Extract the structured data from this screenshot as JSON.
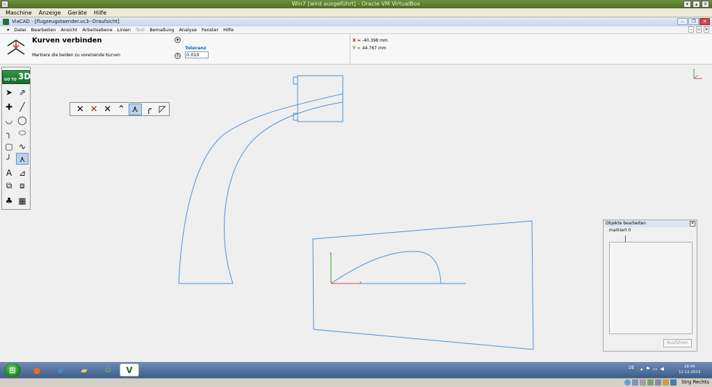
{
  "vbox": {
    "title": "Win7 [wird ausgeführt] - Oracle VM VirtualBox",
    "menu": [
      "Maschine",
      "Anzeige",
      "Geräte",
      "Hilfe"
    ],
    "host_key": "Strg Rechts"
  },
  "app": {
    "title": "ViaCAD - [flugzeugstaender.vc3--Draufsicht]",
    "menu": [
      "Datei",
      "Bearbeiten",
      "Ansicht",
      "Arbeitsebene",
      "Linien",
      "Text",
      "Bemaßung",
      "Analyse",
      "Fenster",
      "Hilfe"
    ],
    "menu_disabled": [
      "Text"
    ]
  },
  "command": {
    "title": "Kurven verbinden",
    "hint": "Markiere die beiden zu vereinende Kurven",
    "tolerance_label": "Toleranz",
    "tolerance_value": "0.010"
  },
  "coords": {
    "x_label": "X =",
    "x_value": "-40.398 mm",
    "y_label": "Y =",
    "y_value": "44.767 mm"
  },
  "toolbox": {
    "goto_label": "GO TO",
    "goto_3d": "3D"
  },
  "obj_panel": {
    "title": "Objekte bearbeiten",
    "marked": "markiert 0",
    "button": "Ausführen"
  },
  "taskbar": {
    "lang": "DE",
    "time": "18:44",
    "date": "12.12.2013"
  },
  "colors": {
    "geometry": "#4a8fd4",
    "axis_x": "#d04040",
    "axis_y": "#3a9a2a"
  }
}
